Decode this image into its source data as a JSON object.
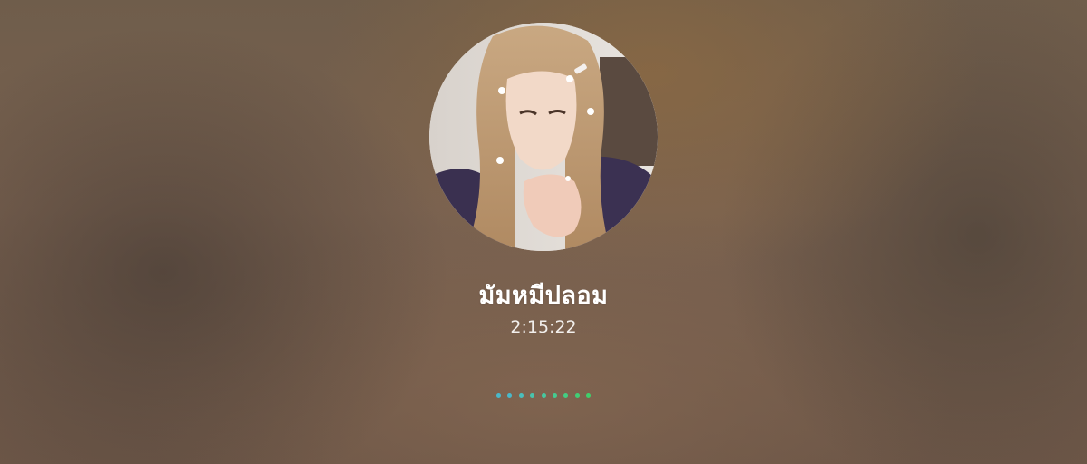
{
  "call": {
    "caller_name": "มัมหมีปลอม",
    "duration": "2:15:22"
  },
  "avatar": {
    "alt": "profile photo"
  },
  "indicator": {
    "dot_colors": [
      "#4ab8c9",
      "#4ab8c9",
      "#4abfbd",
      "#49c4ad",
      "#47c89f",
      "#45cb90",
      "#43cd82",
      "#41ce75",
      "#3fcf6b"
    ]
  },
  "colors": {
    "background": "#6e5a48",
    "text": "#ffffff"
  }
}
